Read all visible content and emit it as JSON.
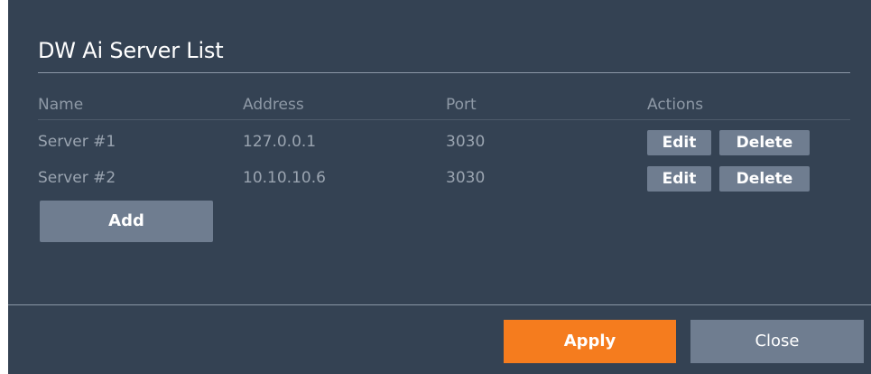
{
  "dialog": {
    "title": "DW Ai Server List",
    "columns": {
      "name": "Name",
      "address": "Address",
      "port": "Port",
      "actions": "Actions"
    },
    "servers": [
      {
        "name": "Server #1",
        "address": "127.0.0.1",
        "port": "3030"
      },
      {
        "name": "Server #2",
        "address": "10.10.10.6",
        "port": "3030"
      }
    ],
    "row_actions": {
      "edit_label": "Edit",
      "delete_label": "Delete"
    },
    "add_label": "Add",
    "apply_label": "Apply",
    "close_label": "Close"
  },
  "colors": {
    "dialog_bg": "#344253",
    "button_gray": "#6f7d90",
    "apply_orange": "#f57c1e",
    "text_muted": "#9aa4b0",
    "title_text": "#ffffff"
  }
}
